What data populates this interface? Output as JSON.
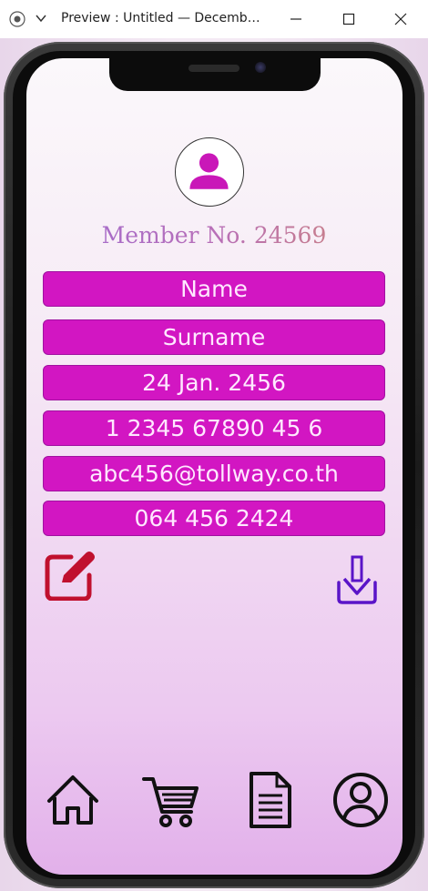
{
  "window": {
    "title": "Preview : Untitled — Decemb…"
  },
  "profile": {
    "member_label": "Member No. 24569"
  },
  "fields": [
    {
      "value": "Name"
    },
    {
      "value": "Surname"
    },
    {
      "value": "24 Jan. 2456"
    },
    {
      "value": "1 2345 67890 45 6"
    },
    {
      "value": "abc456@tollway.co.th"
    },
    {
      "value": "064 456 2424"
    }
  ],
  "actions": {
    "edit_icon": "edit-icon",
    "download_icon": "download-icon"
  },
  "nav": [
    {
      "icon": "home-icon"
    },
    {
      "icon": "cart-icon"
    },
    {
      "icon": "document-icon"
    },
    {
      "icon": "user-icon"
    }
  ],
  "colors": {
    "field_bg": "#d216c2",
    "edit_accent": "#c0102e",
    "download_accent": "#5a14c8",
    "avatar_icon": "#c917b8"
  }
}
